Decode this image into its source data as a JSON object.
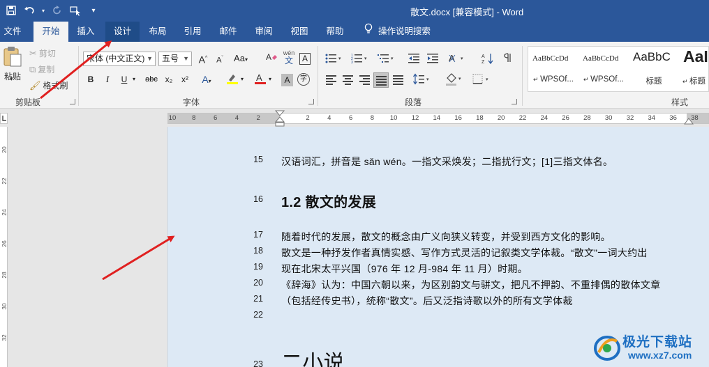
{
  "window": {
    "title": "散文.docx [兼容模式]  -  Word"
  },
  "colors": {
    "accent": "#2b579a",
    "arrow": "#e02020",
    "page_bg": "#dde9f5"
  },
  "quick_access": {
    "save_icon": "save-icon",
    "undo_icon": "undo-icon",
    "redo_icon": "redo-icon",
    "customize_icon": "customize-qat-icon"
  },
  "tabs": [
    {
      "label": "文件"
    },
    {
      "label": "开始"
    },
    {
      "label": "插入"
    },
    {
      "label": "设计"
    },
    {
      "label": "布局"
    },
    {
      "label": "引用"
    },
    {
      "label": "邮件"
    },
    {
      "label": "审阅"
    },
    {
      "label": "视图"
    },
    {
      "label": "帮助"
    }
  ],
  "tell_me": "操作说明搜索",
  "ribbon": {
    "clipboard": {
      "paste": "粘贴",
      "cut": "剪切",
      "copy": "复制",
      "format_painter": "格式刷",
      "label": "剪贴板"
    },
    "font": {
      "font_name": "宋体 (中文正文)",
      "font_size": "五号",
      "label": "字体",
      "bold": "B",
      "italic": "I",
      "underline": "U",
      "strike": "abc",
      "subscript": "x₂",
      "superscript": "x²",
      "grow": "A",
      "shrink": "A",
      "change_case": "Aa",
      "phonetic": "wén\n文",
      "char_border": "A",
      "char_shading": "A",
      "enclose": "字"
    },
    "paragraph": {
      "label": "段落"
    },
    "styles": {
      "label": "样式",
      "items": [
        {
          "preview": "AaBbCcDd",
          "name": "WPSOf..."
        },
        {
          "preview": "AaBbCcDd",
          "name": "WPSOf..."
        },
        {
          "preview": "AaBbC",
          "name": "标题"
        },
        {
          "preview": "AaI",
          "name": "标题"
        }
      ]
    }
  },
  "ruler": {
    "numbers": [
      "10",
      "8",
      "6",
      "4",
      "2",
      "2",
      "4",
      "6",
      "8",
      "10",
      "12",
      "14",
      "16",
      "18",
      "20",
      "22",
      "24",
      "26",
      "28",
      "30",
      "32",
      "34",
      "36",
      "38"
    ]
  },
  "vertical_ruler": {
    "numbers": [
      "20",
      "22",
      "24",
      "26",
      "28",
      "30",
      "32"
    ]
  },
  "document": {
    "lines": [
      {
        "num": "15",
        "text": "汉语词汇，拼音是 sǎn wén。一指文采焕发；二指扰行文；[1]三指文体名。",
        "style": "normal"
      },
      {
        "num": "16",
        "text": "1.2 散文的发展",
        "style": "heading"
      },
      {
        "num": "17",
        "text": "随着时代的发展，散文的概念由广义向狭义转变，并受到西方文化的影响。",
        "style": "normal"
      },
      {
        "num": "18",
        "text": "散文是一种抒发作者真情实感、写作方式灵活的记叙类文学体裁。“散文”一词大约出",
        "style": "normal"
      },
      {
        "num": "19",
        "text": "现在北宋太平兴国（976 年 12 月-984 年 11 月）时期。",
        "style": "normal"
      },
      {
        "num": "20",
        "text": "《辞海》认为：中国六朝以来，为区别韵文与骈文，把凡不押韵、不重排偶的散体文章",
        "style": "normal"
      },
      {
        "num": "21",
        "text": "（包括经传史书），统称“散文”。后又泛指诗歌以外的所有文学体裁",
        "style": "normal"
      },
      {
        "num": "22",
        "text": "",
        "style": "normal"
      },
      {
        "num": "23",
        "text": "二小说",
        "style": "big"
      }
    ]
  },
  "watermark": {
    "title": "极光下载站",
    "url": "www.xz7.com"
  }
}
